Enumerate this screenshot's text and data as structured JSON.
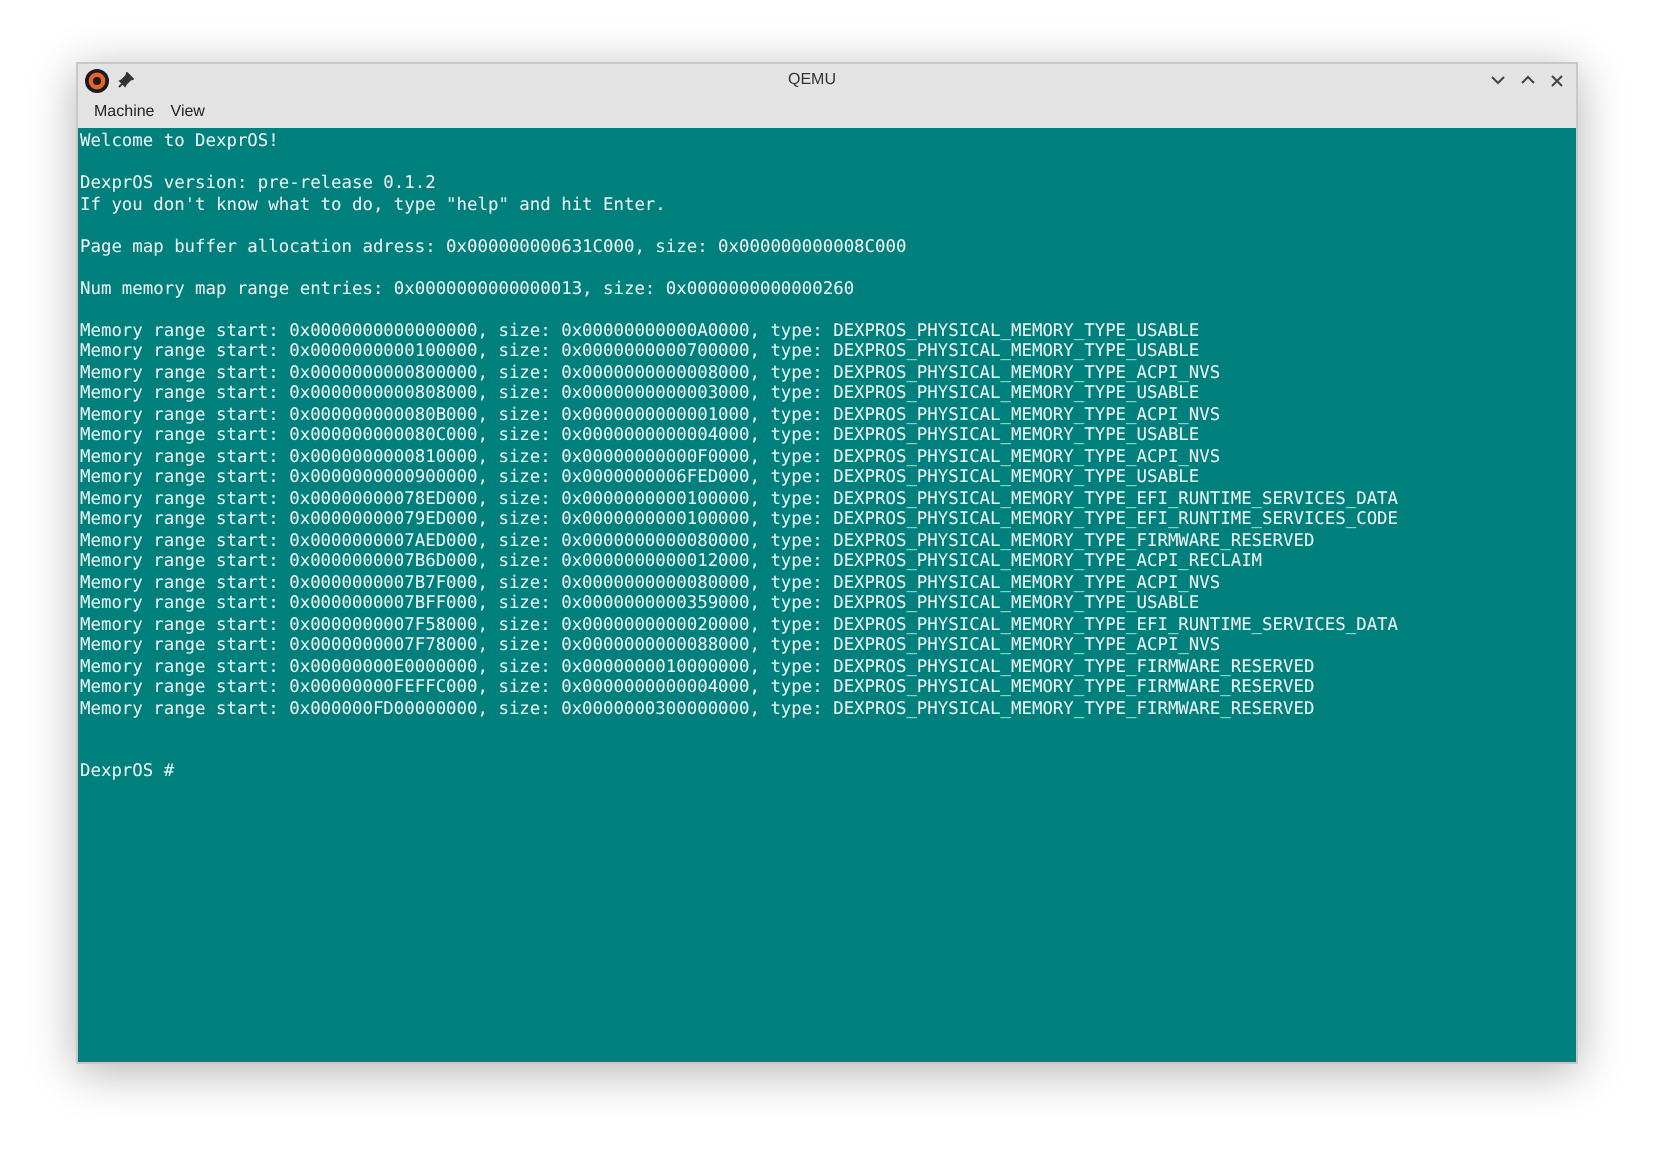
{
  "window": {
    "title": "QEMU"
  },
  "menu": [
    "Machine",
    "View"
  ],
  "console": {
    "paragraphs": [
      [
        "Welcome to DexprOS!"
      ],
      [
        "DexprOS version: pre-release 0.1.2",
        "If you don't know what to do, type \"help\" and hit Enter."
      ],
      [
        "Page map buffer allocation adress: 0x000000000631C000, size: 0x000000000008C000"
      ],
      [
        "Num memory map range entries: 0x0000000000000013, size: 0x0000000000000260"
      ],
      [
        "Memory range start: 0x0000000000000000, size: 0x00000000000A0000, type: DEXPROS_PHYSICAL_MEMORY_TYPE_USABLE",
        "Memory range start: 0x0000000000100000, size: 0x0000000000700000, type: DEXPROS_PHYSICAL_MEMORY_TYPE_USABLE",
        "Memory range start: 0x0000000000800000, size: 0x0000000000008000, type: DEXPROS_PHYSICAL_MEMORY_TYPE_ACPI_NVS",
        "Memory range start: 0x0000000000808000, size: 0x0000000000003000, type: DEXPROS_PHYSICAL_MEMORY_TYPE_USABLE",
        "Memory range start: 0x000000000080B000, size: 0x0000000000001000, type: DEXPROS_PHYSICAL_MEMORY_TYPE_ACPI_NVS",
        "Memory range start: 0x000000000080C000, size: 0x0000000000004000, type: DEXPROS_PHYSICAL_MEMORY_TYPE_USABLE",
        "Memory range start: 0x0000000000810000, size: 0x00000000000F0000, type: DEXPROS_PHYSICAL_MEMORY_TYPE_ACPI_NVS",
        "Memory range start: 0x0000000000900000, size: 0x0000000006FED000, type: DEXPROS_PHYSICAL_MEMORY_TYPE_USABLE",
        "Memory range start: 0x00000000078ED000, size: 0x0000000000100000, type: DEXPROS_PHYSICAL_MEMORY_TYPE_EFI_RUNTIME_SERVICES_DATA",
        "Memory range start: 0x00000000079ED000, size: 0x0000000000100000, type: DEXPROS_PHYSICAL_MEMORY_TYPE_EFI_RUNTIME_SERVICES_CODE",
        "Memory range start: 0x0000000007AED000, size: 0x0000000000080000, type: DEXPROS_PHYSICAL_MEMORY_TYPE_FIRMWARE_RESERVED",
        "Memory range start: 0x0000000007B6D000, size: 0x0000000000012000, type: DEXPROS_PHYSICAL_MEMORY_TYPE_ACPI_RECLAIM",
        "Memory range start: 0x0000000007B7F000, size: 0x0000000000080000, type: DEXPROS_PHYSICAL_MEMORY_TYPE_ACPI_NVS",
        "Memory range start: 0x0000000007BFF000, size: 0x0000000000359000, type: DEXPROS_PHYSICAL_MEMORY_TYPE_USABLE",
        "Memory range start: 0x0000000007F58000, size: 0x0000000000020000, type: DEXPROS_PHYSICAL_MEMORY_TYPE_EFI_RUNTIME_SERVICES_DATA",
        "Memory range start: 0x0000000007F78000, size: 0x0000000000088000, type: DEXPROS_PHYSICAL_MEMORY_TYPE_ACPI_NVS",
        "Memory range start: 0x00000000E0000000, size: 0x0000000010000000, type: DEXPROS_PHYSICAL_MEMORY_TYPE_FIRMWARE_RESERVED",
        "Memory range start: 0x00000000FEFFC000, size: 0x0000000000004000, type: DEXPROS_PHYSICAL_MEMORY_TYPE_FIRMWARE_RESERVED",
        "Memory range start: 0x000000FD00000000, size: 0x0000000300000000, type: DEXPROS_PHYSICAL_MEMORY_TYPE_FIRMWARE_RESERVED"
      ]
    ],
    "prompt": "DexprOS #"
  }
}
